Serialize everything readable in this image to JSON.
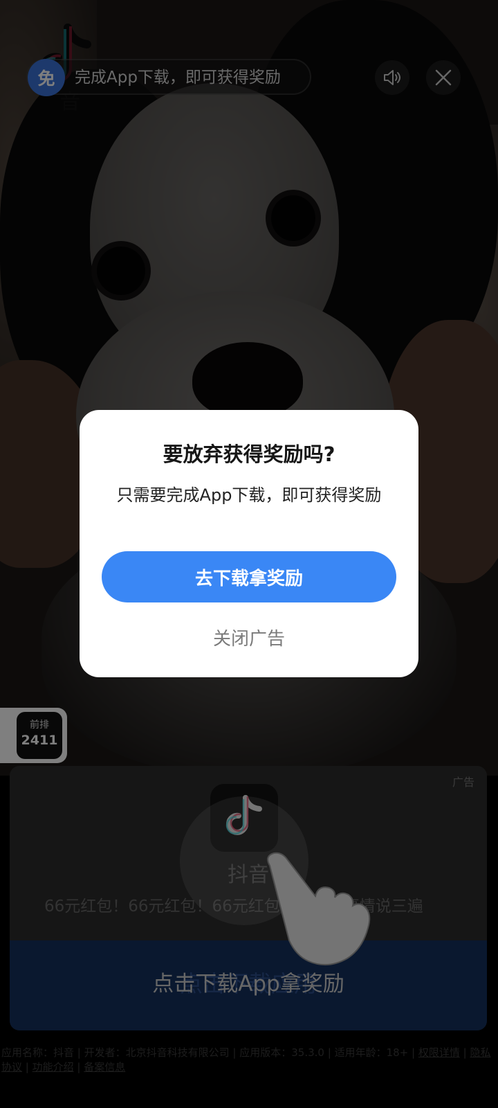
{
  "top_bar": {
    "free_badge": "免",
    "reward_text": "完成App下载，即可获得奖励",
    "volume_icon": "speaker-icon",
    "close_icon": "close-icon",
    "logo_ghost_text": "音"
  },
  "rank": {
    "label": "前排",
    "value": "2411"
  },
  "app_card": {
    "ad_tag": "广告",
    "app_name": "抖音",
    "slogan": "66元红包！66元红包！66元红包！重要的事情说三遍",
    "download_label": "点击下载App拿奖励",
    "download_ghost": "点击下载应用"
  },
  "footer": {
    "app_name_label": "应用名称：抖音",
    "developer_label": "开发者：北京抖音科技有限公司",
    "version_label": "应用版本：35.3.0",
    "age_label": "适用年龄：18+",
    "permissions": "权限详情",
    "privacy": "隐私协议",
    "features": "功能介绍",
    "filing": "备案信息"
  },
  "modal": {
    "title": "要放弃获得奖励吗?",
    "body": "只需要完成App下载，即可获得奖励",
    "cta": "去下载拿奖励",
    "close": "关闭广告"
  },
  "colors": {
    "accent": "#3a87f5",
    "badge_blue": "#3a72d8",
    "download_bar": "#15305e"
  }
}
